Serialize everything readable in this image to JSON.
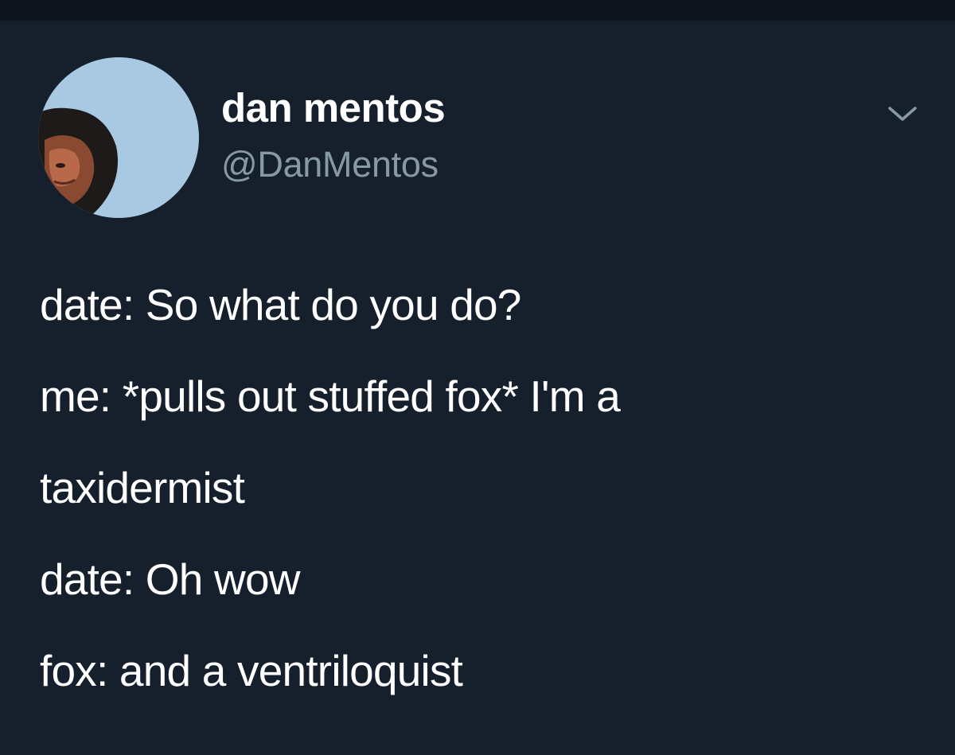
{
  "tweet": {
    "display_name": "dan mentos",
    "handle": "@DanMentos",
    "menu_icon": "chevron-down-icon",
    "avatar_icon": "profile-photo",
    "lines": [
      "date: So what do you do?",
      "me: *pulls out stuffed fox* I'm a",
      "taxidermist",
      "date: Oh wow",
      "fox: and a ventriloquist"
    ]
  },
  "colors": {
    "background": "#16202c",
    "text": "#ffffff",
    "secondary_text": "#8899a6",
    "avatar_bg": "#a9c9e2"
  }
}
